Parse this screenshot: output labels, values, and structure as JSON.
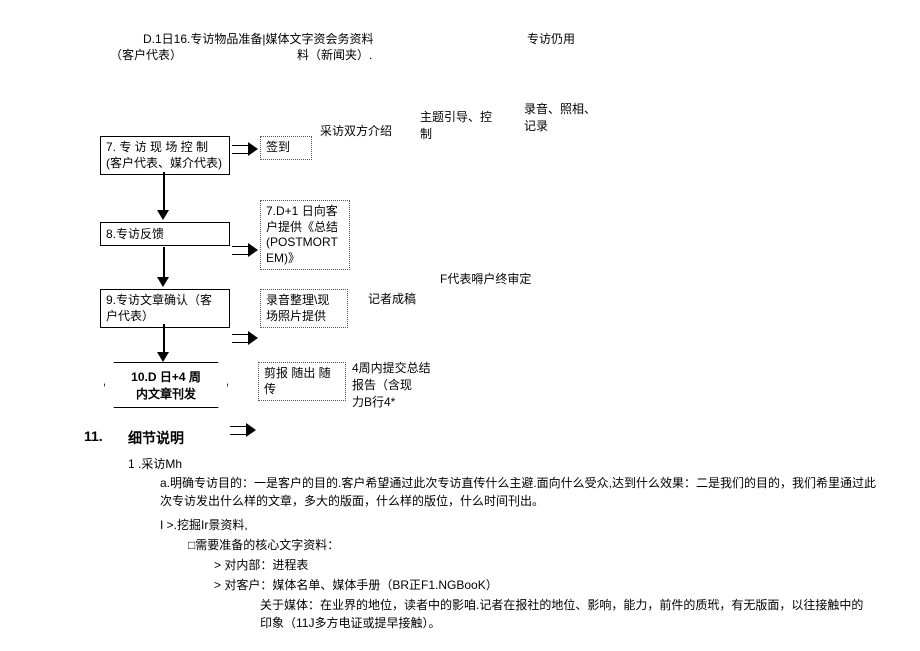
{
  "top": {
    "line1_left": "D.1日16.专访物品准备|媒体文字资会务资料",
    "line2_left": "（客户代表）",
    "line2_mid": "料（新闻夹）.",
    "line1_right": "专访仍用"
  },
  "annot": {
    "a1": "采访双方介绍",
    "a2_1": "主题引导、控",
    "a2_2": "制",
    "a3_1": "录音、照相、",
    "a3_2": "记录",
    "a4": "记者成稿",
    "a5": "F代表嘚户终审定",
    "a6_1": "4周内提交总结",
    "a6_2": "报告（含现",
    "a6_3": "力B行4*"
  },
  "flow": {
    "b7_l1": "7. 专 访 现 场 控 制",
    "b7_l2": "(客户代表、媒介代表)",
    "b7r": "签到",
    "b8": "8.专访反馈",
    "b8r_l1": "7.D+1 日向客",
    "b8r_l2": "户提供《总结",
    "b8r_l3": "(POSTMORT",
    "b8r_l4": "EM)》",
    "b9_l1": "9.专访文章确认（客",
    "b9_l2": "户代表）",
    "b9r_l1": "录音整理\\现",
    "b9r_l2": "场照片提供",
    "b10_l1": "10.D 日+4 周",
    "b10_l2": "内文章刊发",
    "b10r_l1": "剪报 随出 随",
    "b10r_l2": "传"
  },
  "section": {
    "num": "11.",
    "title": "细节说明",
    "s1": "1 .采访Mh",
    "a": "a.明确专访目的：一是客户的目的.客户希望通过此次专访直传什么主避.面向什么受众,达到什么效果：二是我们的目的，我们希里通过此次专访发出什么样的文章，多大的版面，什么样的版位，什么时间刊出。",
    "b_title": "I >.挖掘Ir景资料,",
    "b_1": "□需要准备的核心文字资料：",
    "b_1_1": "> 对内部：进程表",
    "b_1_2": "> 对客户：媒体名单、媒体手册（BR正F1.NGBooK）",
    "b_1_3": "关于媒体：在业界的地位，读者中的影咱.记者在报社的地位、影响，能力，前件的质玳，有无版面，以往接触中的印象（11J多方电证或提早接触）。"
  }
}
